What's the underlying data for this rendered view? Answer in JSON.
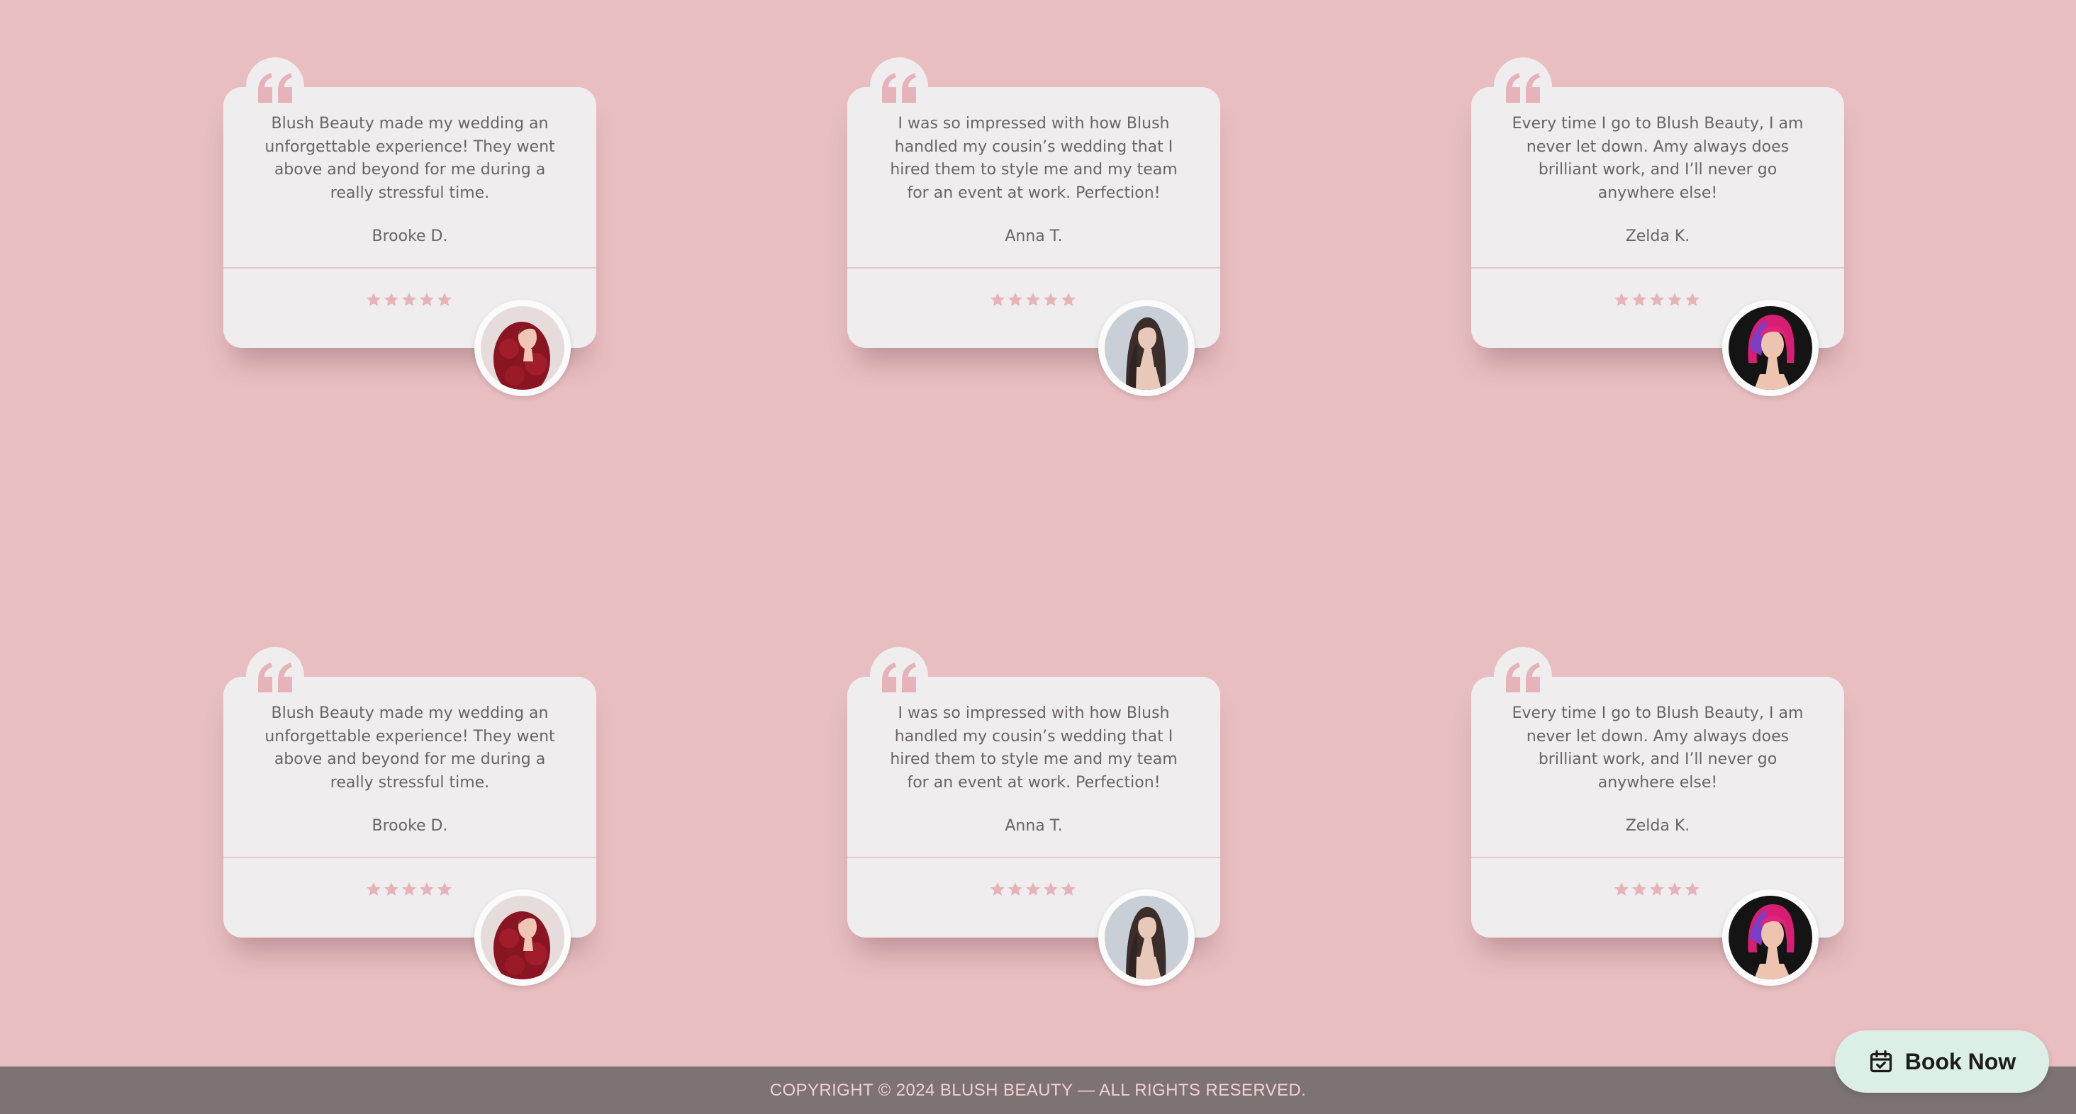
{
  "testimonials": [
    {
      "quote": "Blush Beauty made my wedding an unforgettable experience! They went above and beyond for me during a really stressful time.",
      "author": "Brooke D.",
      "rating": 5,
      "avatar": "red-curly-hair-woman"
    },
    {
      "quote": "I was so impressed with how Blush handled my cousin’s wedding that I hired them to style me and my team for an event at work. Perfection!",
      "author": "Anna T.",
      "rating": 5,
      "avatar": "straight-brown-hair-woman"
    },
    {
      "quote": "Every time I go to Blush Beauty, I am never let down. Amy always does brilliant work, and I’ll never go anywhere else!",
      "author": "Zelda K.",
      "rating": 5,
      "avatar": "pink-bob-hair-woman"
    },
    {
      "quote": "Blush Beauty made my wedding an unforgettable experience! They went above and beyond for me during a really stressful time.",
      "author": "Brooke D.",
      "rating": 5,
      "avatar": "red-curly-hair-woman"
    },
    {
      "quote": "I was so impressed with how Blush handled my cousin’s wedding that I hired them to style me and my team for an event at work. Perfection!",
      "author": "Anna T.",
      "rating": 5,
      "avatar": "straight-brown-hair-woman"
    },
    {
      "quote": "Every time I go to Blush Beauty, I am never let down. Amy always does brilliant work, and I’ll never go anywhere else!",
      "author": "Zelda K.",
      "rating": 5,
      "avatar": "pink-bob-hair-woman"
    }
  ],
  "footer": {
    "copyright": "COPYRIGHT © 2024 BLUSH BEAUTY — ALL RIGHTS RESERVED."
  },
  "book_button": {
    "label": "Book Now",
    "icon": "calendar-check-icon"
  },
  "colors": {
    "background": "#e8bec1",
    "card": "#efedee",
    "accent_pink": "#e5b3b8",
    "footer_bg": "#7d7373",
    "footer_text": "#f2cfd2",
    "button_bg": "#dcefe6"
  }
}
